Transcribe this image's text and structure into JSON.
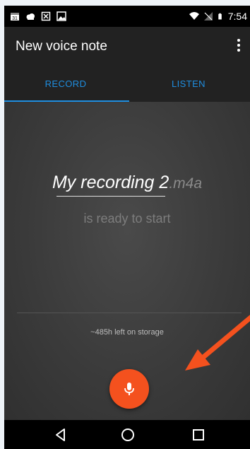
{
  "status_bar": {
    "time": "7:54",
    "left_icons": [
      "calendar-icon",
      "cloud-icon",
      "excel-icon",
      "gallery-icon"
    ],
    "right_icons": [
      "wifi-icon",
      "no-signal-icon",
      "battery-icon"
    ]
  },
  "app_bar": {
    "title": "New voice note",
    "overflow_icon": "more-vert-icon"
  },
  "tabs": [
    {
      "label": "RECORD",
      "selected": true
    },
    {
      "label": "LISTEN",
      "selected": false
    }
  ],
  "recording": {
    "name": "My recording 2",
    "extension": ".m4a",
    "status": "is ready to start",
    "storage_left": "~485h left on storage"
  },
  "record_button": {
    "icon": "microphone-icon",
    "color": "#f4511e"
  },
  "annotation": {
    "icon": "arrow-icon",
    "color": "#f4511e"
  },
  "nav_bar": {
    "icons": [
      "back-icon",
      "home-icon",
      "recents-icon"
    ]
  },
  "colors": {
    "accent": "#1f8ee0",
    "record": "#f4511e",
    "app_bar": "#222222"
  }
}
